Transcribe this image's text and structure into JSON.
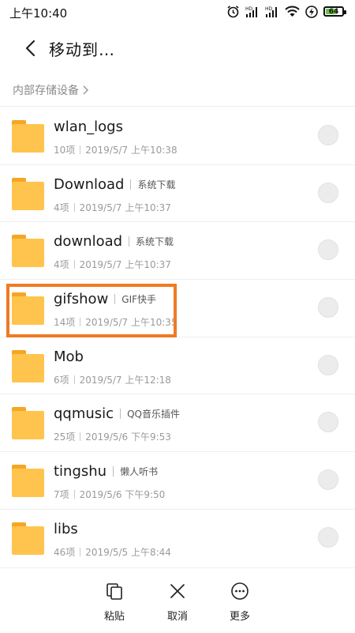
{
  "status_bar": {
    "time": "上午10:40",
    "battery": "64",
    "icons": [
      "alarm-icon",
      "hd-signal-icon",
      "hd-signal-icon",
      "wifi-icon",
      "charging-icon",
      "battery-icon"
    ]
  },
  "header": {
    "title": "移动到…",
    "back_icon": "back-arrow-icon"
  },
  "breadcrumb": {
    "label": "内部存储设备"
  },
  "folders": [
    {
      "name": "wlan_logs",
      "tag": "",
      "count": "10项",
      "date": "2019/5/7 上午10:38"
    },
    {
      "name": "Download",
      "tag": "系统下载",
      "count": "4项",
      "date": "2019/5/7 上午10:37"
    },
    {
      "name": "download",
      "tag": "系统下载",
      "count": "4项",
      "date": "2019/5/7 上午10:37"
    },
    {
      "name": "gifshow",
      "tag": "GIF快手",
      "count": "14项",
      "date": "2019/5/7 上午10:35",
      "highlighted": true
    },
    {
      "name": "Mob",
      "tag": "",
      "count": "6项",
      "date": "2019/5/7 上午12:18"
    },
    {
      "name": "qqmusic",
      "tag": "QQ音乐插件",
      "count": "25项",
      "date": "2019/5/6 下午9:53"
    },
    {
      "name": "tingshu",
      "tag": "懒人听书",
      "count": "7项",
      "date": "2019/5/6 下午9:50"
    },
    {
      "name": "libs",
      "tag": "",
      "count": "46项",
      "date": "2019/5/5 上午8:44"
    }
  ],
  "bottom_bar": {
    "paste_label": "粘贴",
    "cancel_label": "取消",
    "more_label": "更多"
  },
  "colors": {
    "folder": "#ffc44d",
    "highlight": "#f07b23",
    "battery_fill": "#6cc24a"
  }
}
